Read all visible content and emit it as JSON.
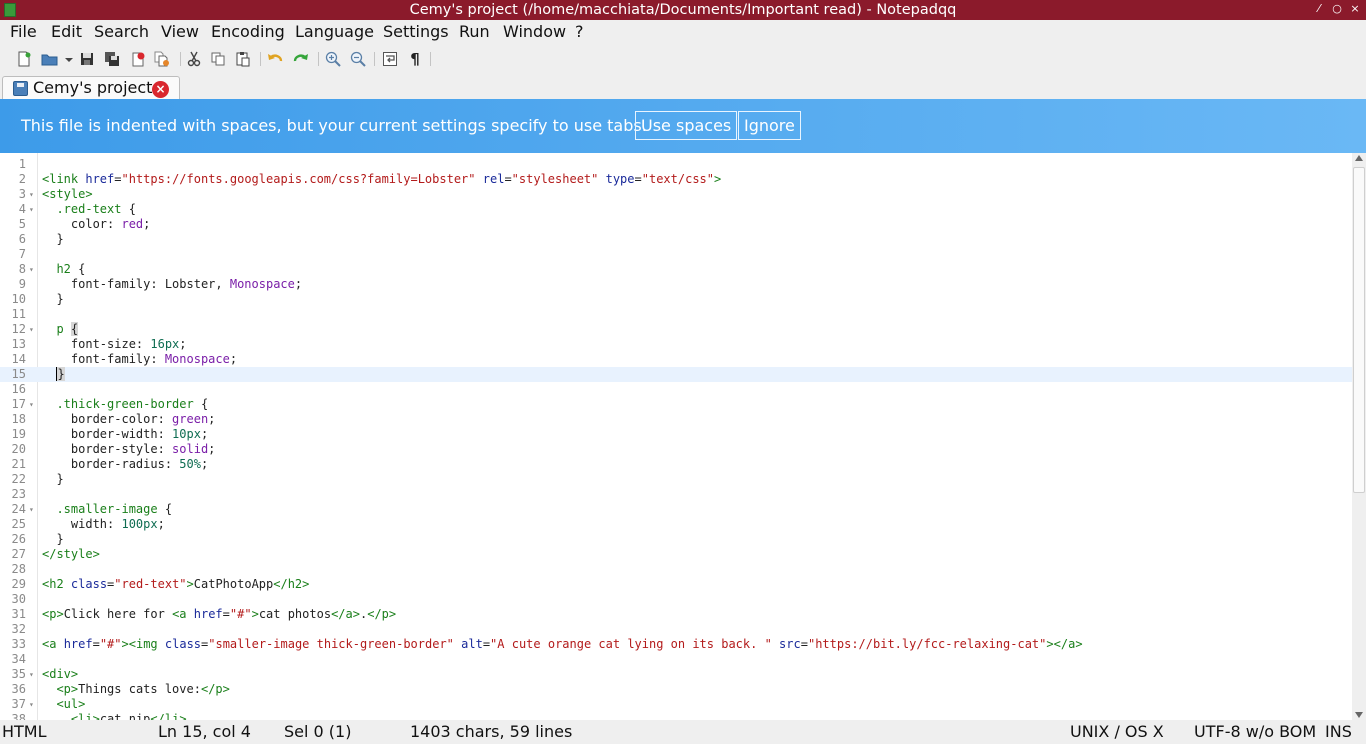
{
  "window": {
    "title": "Cemy's project (/home/macchiata/Documents/Important read) - Notepadqq",
    "buttons": [
      "⁄",
      "○",
      "×"
    ]
  },
  "menu": [
    "File",
    "Edit",
    "Search",
    "View",
    "Encoding",
    "Language",
    "Settings",
    "Run",
    "Window",
    "?"
  ],
  "toolbar_icons": [
    "new-file-icon",
    "open-file-icon",
    "save-icon",
    "save-all-icon",
    "close-file-icon",
    "close-all-icon",
    "cut-icon",
    "copy-icon",
    "paste-icon",
    "undo-icon",
    "redo-icon",
    "zoom-in-icon",
    "zoom-out-icon",
    "word-wrap-icon",
    "show-whitespace-icon"
  ],
  "tab": {
    "label": "Cemy's project"
  },
  "banner": {
    "message": "This file is indented with spaces, but your current settings specify to use tabs.",
    "use_spaces": "Use spaces",
    "ignore": "Ignore"
  },
  "editor": {
    "active_line": 15,
    "lines": [
      "",
      "<link href=\"https://fonts.googleapis.com/css?family=Lobster\" rel=\"stylesheet\" type=\"text/css\">",
      "<style>",
      "  .red-text {",
      "    color: red;",
      "  }",
      "",
      "  h2 {",
      "    font-family: Lobster, Monospace;",
      "  }",
      "",
      "  p {",
      "    font-size: 16px;",
      "    font-family: Monospace;",
      "  }",
      "",
      "  .thick-green-border {",
      "    border-color: green;",
      "    border-width: 10px;",
      "    border-style: solid;",
      "    border-radius: 50%;",
      "  }",
      "",
      "  .smaller-image {",
      "    width: 100px;",
      "  }",
      "</style>",
      "",
      "<h2 class=\"red-text\">CatPhotoApp</h2>",
      "",
      "<p>Click here for <a href=\"#\">cat photos</a>.</p>",
      "",
      "<a href=\"#\"><img class=\"smaller-image thick-green-border\" alt=\"A cute orange cat lying on its back. \" src=\"https://bit.ly/fcc-relaxing-cat\"></a>",
      "",
      "<div>",
      "  <p>Things cats love:</p>",
      "  <ul>",
      "    <li>cat nip</li>"
    ],
    "fold_lines": [
      3,
      4,
      8,
      12,
      17,
      24,
      35,
      37
    ]
  },
  "status": {
    "language": "HTML",
    "position": "Ln 15, col 4",
    "selection": "Sel 0 (1)",
    "stats": "1403 chars, 59 lines",
    "eol": "UNIX / OS X",
    "encoding": "UTF-8 w/o BOM",
    "mode": "INS"
  }
}
